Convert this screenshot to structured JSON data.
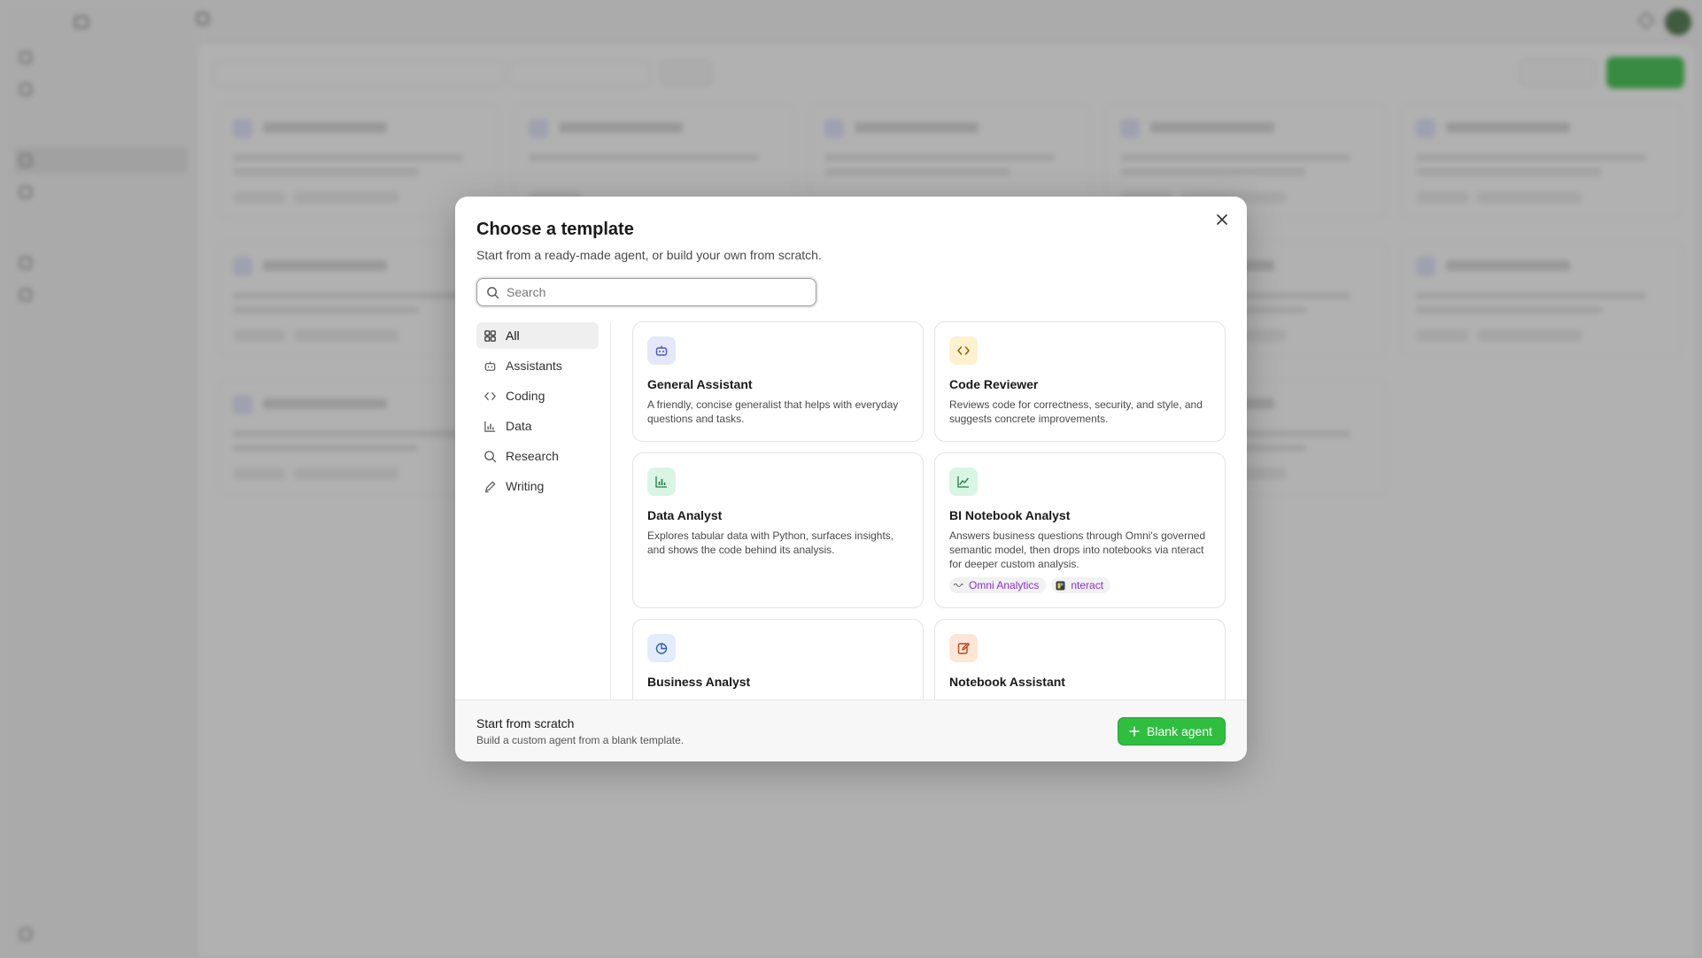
{
  "modal": {
    "title": "Choose a template",
    "subtitle": "Start from a ready-made agent, or build your own from scratch.",
    "search_placeholder": "Search"
  },
  "categories": [
    {
      "label": "All",
      "icon": "grid-icon",
      "active": true
    },
    {
      "label": "Assistants",
      "icon": "robot-icon",
      "active": false
    },
    {
      "label": "Coding",
      "icon": "code-icon",
      "active": false
    },
    {
      "label": "Data",
      "icon": "bar-chart-icon",
      "active": false
    },
    {
      "label": "Research",
      "icon": "search-icon",
      "active": false
    },
    {
      "label": "Writing",
      "icon": "pen-icon",
      "active": false
    }
  ],
  "templates": [
    {
      "name": "General Assistant",
      "description": "A friendly, concise generalist that helps with everyday questions and tasks.",
      "icon": "robot-icon",
      "icon_bg": "#e5e8fb",
      "icon_color": "#4a55c8"
    },
    {
      "name": "Code Reviewer",
      "description": "Reviews code for correctness, security, and style, and suggests concrete improvements.",
      "icon": "code-icon",
      "icon_bg": "#fdf1cf",
      "icon_color": "#8a6400"
    },
    {
      "name": "Data Analyst",
      "description": "Explores tabular data with Python, surfaces insights, and shows the code behind its analysis.",
      "icon": "bar-chart-icon",
      "icon_bg": "#d9f5e4",
      "icon_color": "#1d7a45"
    },
    {
      "name": "BI Notebook Analyst",
      "description": "Answers business questions through Omni's governed semantic model, then drops into notebooks via nteract for deeper custom analysis.",
      "icon": "line-chart-icon",
      "icon_bg": "#d9f5e4",
      "icon_color": "#1d7a45",
      "tags": [
        {
          "label": "Omni Analytics",
          "icon": "omni-logo-icon"
        },
        {
          "label": "nteract",
          "icon": "nteract-logo-icon"
        }
      ]
    },
    {
      "name": "Business Analyst",
      "description": "",
      "icon": "pie-chart-icon",
      "icon_bg": "#e2ecfb",
      "icon_color": "#2d5fb8"
    },
    {
      "name": "Notebook Assistant",
      "description": "",
      "icon": "notebook-edit-icon",
      "icon_bg": "#fde6d6",
      "icon_color": "#b8441a"
    }
  ],
  "footer": {
    "title": "Start from scratch",
    "subtitle": "Build a custom agent from a blank template.",
    "button_label": "Blank agent"
  },
  "colors": {
    "accent_green": "#2fbe3f",
    "tag_text": "#8a2fd4"
  }
}
